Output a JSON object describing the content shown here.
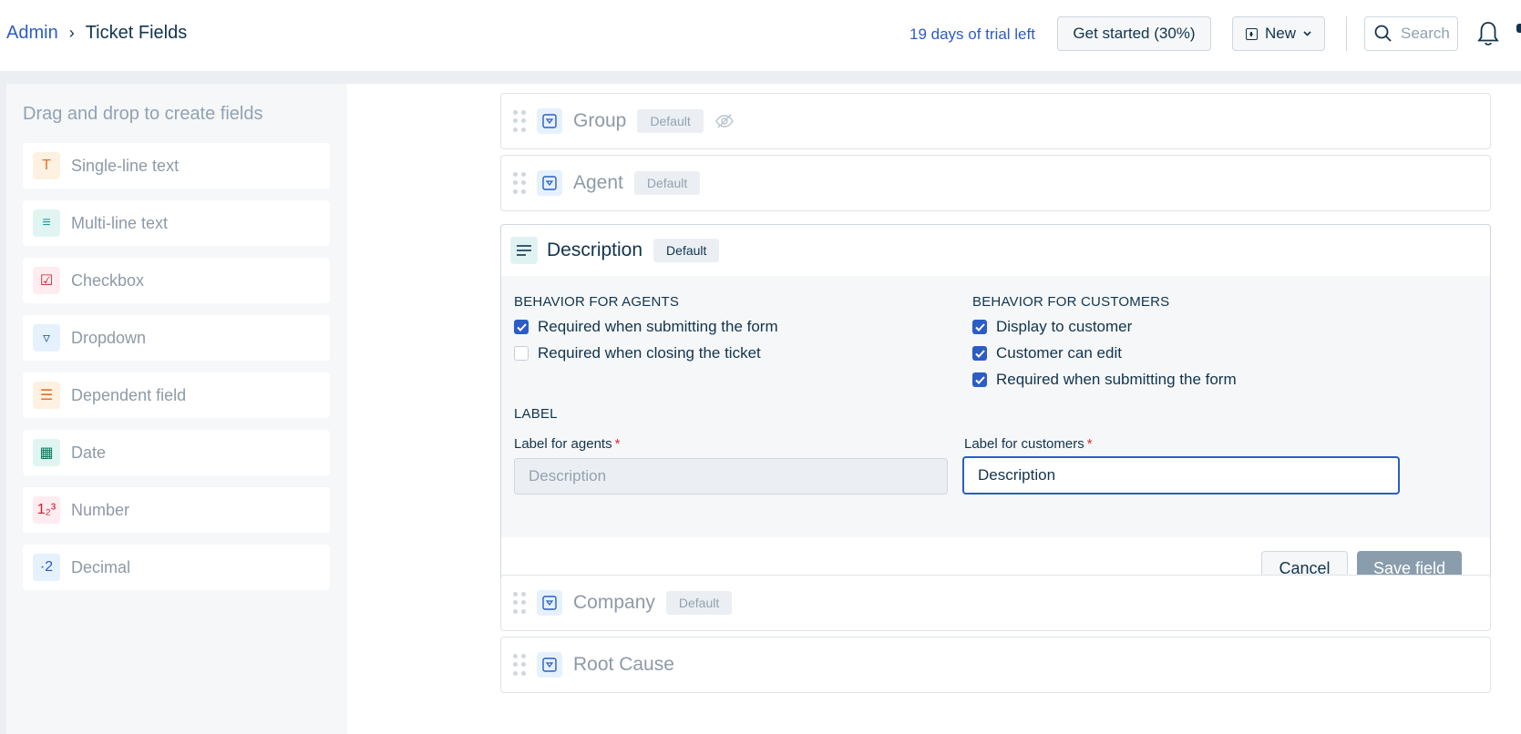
{
  "breadcrumb": {
    "root": "Admin",
    "current": "Ticket Fields"
  },
  "header": {
    "trial_text": "19 days of trial left",
    "get_started": "Get started (30%)",
    "new_label": "New",
    "search_placeholder": "Search"
  },
  "sidebar": {
    "title": "Drag and drop to create fields",
    "items": [
      {
        "label": "Single-line text",
        "icon": "text-icon",
        "glyph": "T",
        "color": "#e86f25",
        "bg": "#fef1e1"
      },
      {
        "label": "Multi-line text",
        "icon": "paragraph-icon",
        "glyph": "≡",
        "color": "#2c9a9a",
        "bg": "#e0f5f1"
      },
      {
        "label": "Checkbox",
        "icon": "checkbox-icon",
        "glyph": "☑",
        "color": "#c82124",
        "bg": "#ffecf0"
      },
      {
        "label": "Dropdown",
        "icon": "dropdown-icon",
        "glyph": "▿",
        "color": "#2c5cc5",
        "bg": "#e5f2fd"
      },
      {
        "label": "Dependent field",
        "icon": "list-icon",
        "glyph": "☰",
        "color": "#e86f25",
        "bg": "#fef1e1"
      },
      {
        "label": "Date",
        "icon": "calendar-icon",
        "glyph": "▦",
        "color": "#00795b",
        "bg": "#e0f5f1"
      },
      {
        "label": "Number",
        "icon": "number-icon",
        "glyph": "1₂³",
        "color": "#c82124",
        "bg": "#ffecf0"
      },
      {
        "label": "Decimal",
        "icon": "decimal-icon",
        "glyph": "·2",
        "color": "#2c5cc5",
        "bg": "#e5f2fd"
      }
    ]
  },
  "fields": {
    "group": {
      "label": "Group",
      "badge": "Default"
    },
    "agent": {
      "label": "Agent",
      "badge": "Default"
    },
    "company": {
      "label": "Company",
      "badge": "Default"
    },
    "root_cause": {
      "label": "Root Cause"
    }
  },
  "editor": {
    "title": "Description",
    "badge": "Default",
    "agents_heading": "BEHAVIOR FOR AGENTS",
    "customers_heading": "BEHAVIOR FOR CUSTOMERS",
    "agent_options": [
      {
        "label": "Required when submitting the form",
        "checked": true
      },
      {
        "label": "Required when closing the ticket",
        "checked": false
      }
    ],
    "customer_options": [
      {
        "label": "Display to customer",
        "checked": true
      },
      {
        "label": "Customer can edit",
        "checked": true
      },
      {
        "label": "Required when submitting the form",
        "checked": true
      }
    ],
    "label_heading": "LABEL",
    "agent_label_title": "Label for agents",
    "agent_label_value": "Description",
    "customer_label_title": "Label for customers",
    "customer_label_value": "Description",
    "cancel": "Cancel",
    "save": "Save field"
  }
}
